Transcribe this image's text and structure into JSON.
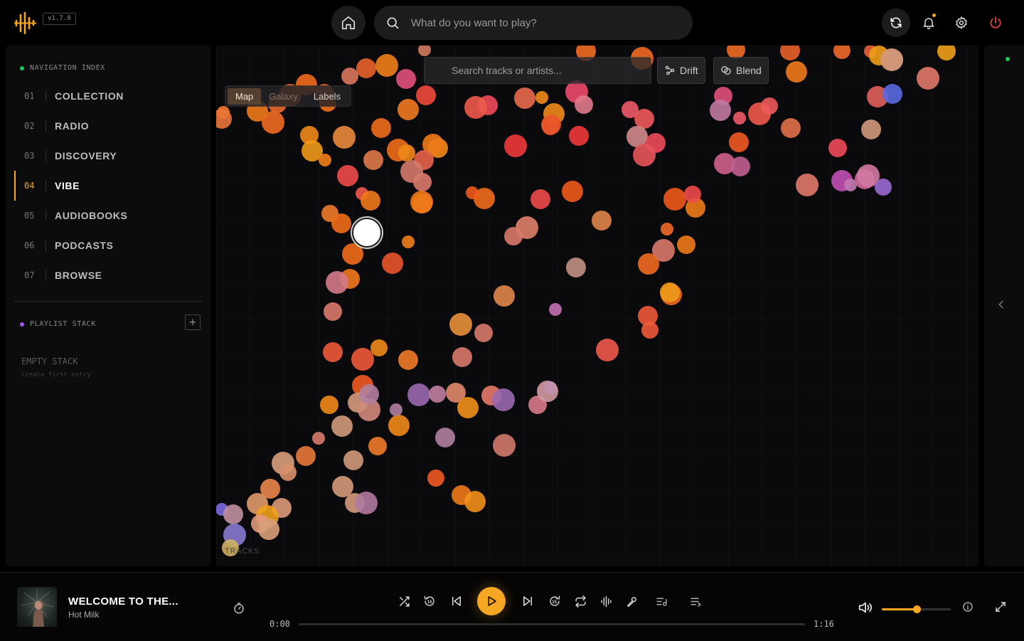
{
  "app": {
    "version": "v1.7.0",
    "accent": "#f5a623"
  },
  "header": {
    "search_placeholder": "What do you want to play?",
    "icons": [
      "home-icon",
      "search-icon",
      "sync-icon",
      "bell-icon",
      "gear-icon",
      "power-icon"
    ]
  },
  "sidebar": {
    "nav_title": "NAVIGATION INDEX",
    "items": [
      {
        "num": "01",
        "label": "COLLECTION"
      },
      {
        "num": "02",
        "label": "RADIO"
      },
      {
        "num": "03",
        "label": "DISCOVERY"
      },
      {
        "num": "04",
        "label": "VIBE",
        "active": true
      },
      {
        "num": "05",
        "label": "AUDIOBOOKS"
      },
      {
        "num": "06",
        "label": "PODCASTS"
      },
      {
        "num": "07",
        "label": "BROWSE"
      }
    ],
    "playlist_title": "PLAYLIST STACK",
    "add_label": "+",
    "empty_title": "EMPTY STACK",
    "empty_sub": "Create first entry"
  },
  "map": {
    "search_placeholder": "Search tracks or artists...",
    "drift_label": "Drift",
    "blend_label": "Blend",
    "views": [
      "Map",
      "Galaxy",
      "Labels"
    ],
    "active_view": "Map",
    "track_count_label": "TRACKS"
  },
  "player": {
    "title": "WELCOME TO THE...",
    "artist": "Hot Milk",
    "time_current": "0:00",
    "time_total": "1:16",
    "progress": 0,
    "volume": 0.5
  }
}
